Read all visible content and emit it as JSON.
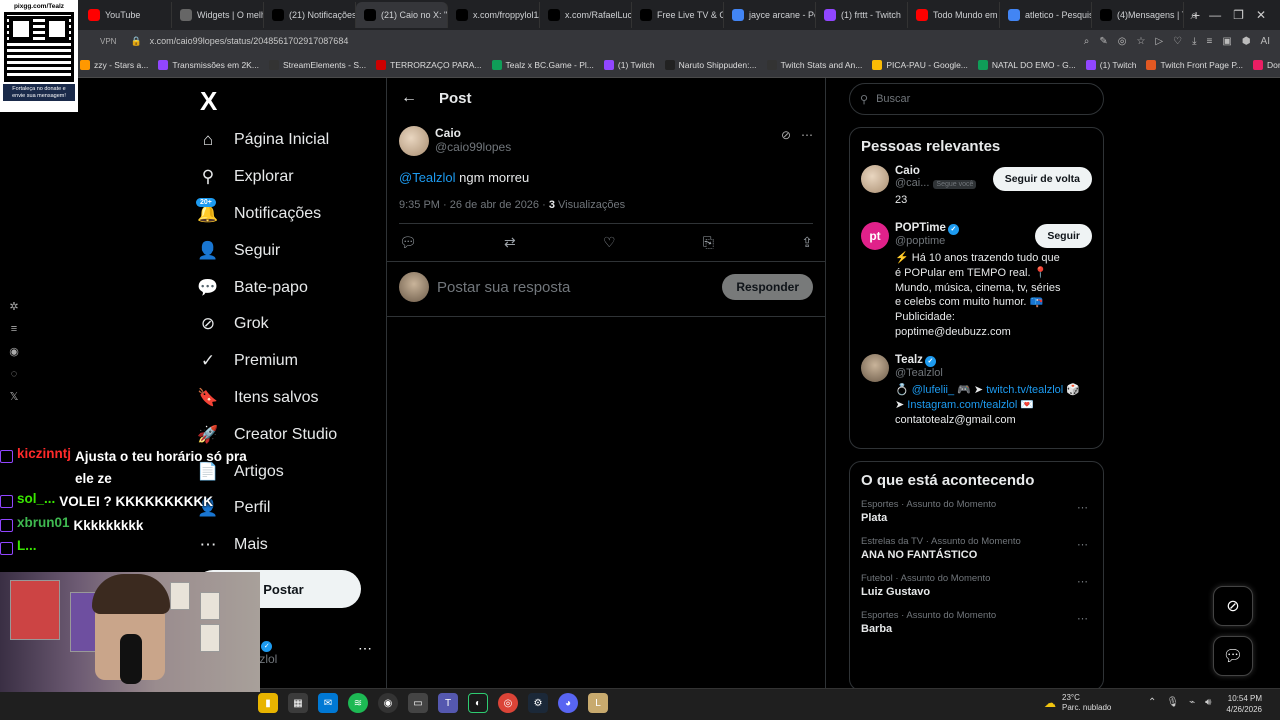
{
  "browser": {
    "tabs": [
      {
        "label": "YouTube",
        "color": "#ff0000"
      },
      {
        "label": "Widgets | O melh",
        "color": "#666"
      },
      {
        "label": "(21) Notificações",
        "color": "#000"
      },
      {
        "label": "(21) Caio no X: \"@popti",
        "color": "#000",
        "active": true
      },
      {
        "label": "x.com/froppylol1/",
        "color": "#000"
      },
      {
        "label": "x.com/RafaelLuce",
        "color": "#000"
      },
      {
        "label": "Free Live TV & On",
        "color": "#000"
      },
      {
        "label": "jayce arcane - Pes",
        "color": "#4285f4"
      },
      {
        "label": "(1) frttt - Twitch",
        "color": "#9146ff"
      },
      {
        "label": "Todo Mundo em",
        "color": "#ff0000"
      },
      {
        "label": "atletico - Pesquis",
        "color": "#4285f4"
      },
      {
        "label": "(4)Mensagens | Ti",
        "color": "#000"
      }
    ],
    "new_tab": "+",
    "vpn": "VPN",
    "url": "x.com/caio99lopes/status/2048561702917087684",
    "bookmarks": [
      {
        "label": "zzy - Stars a...",
        "color": "#ff9800"
      },
      {
        "label": "Transmissões em 2K...",
        "color": "#9146ff"
      },
      {
        "label": "StreamElements - S...",
        "color": "#333"
      },
      {
        "label": "TERRORZAÇO PARA...",
        "color": "#c00"
      },
      {
        "label": "Tealz x BC.Game - Pl...",
        "color": "#0f9d58"
      },
      {
        "label": "(1) Twitch",
        "color": "#9146ff"
      },
      {
        "label": "Naruto Shippuden:...",
        "color": "#222"
      },
      {
        "label": "Twitch Stats and An...",
        "color": "#333"
      },
      {
        "label": "PICA-PAU - Google...",
        "color": "#fbbc05"
      },
      {
        "label": "NATAL DO EMO - G...",
        "color": "#0f9d58"
      },
      {
        "label": "(1) Twitch",
        "color": "#9146ff"
      },
      {
        "label": "Twitch Front Page P...",
        "color": "#e25822"
      },
      {
        "label": "Domo da Mata - Ho...",
        "color": "#e91e63"
      }
    ]
  },
  "qr": {
    "top_text": "pixgg.com/Tealz",
    "bottom_text": "Fortaleça no donate e envie sua mensagem!"
  },
  "nav": {
    "logo": "X",
    "badge": "20+",
    "items": [
      {
        "label": "Página Inicial",
        "icon": "home-icon",
        "glyph": "⌂"
      },
      {
        "label": "Explorar",
        "icon": "search-icon",
        "glyph": "⚲"
      },
      {
        "label": "Notificações",
        "icon": "bell-icon",
        "glyph": "🔔"
      },
      {
        "label": "Seguir",
        "icon": "add-person-icon",
        "glyph": "👤"
      },
      {
        "label": "Bate-papo",
        "icon": "chat-icon",
        "glyph": "💬"
      },
      {
        "label": "Grok",
        "icon": "grok-icon",
        "glyph": "⊘"
      },
      {
        "label": "Premium",
        "icon": "premium-icon",
        "glyph": "✓"
      },
      {
        "label": "Itens salvos",
        "icon": "bookmark-icon",
        "glyph": "🔖"
      },
      {
        "label": "Creator Studio",
        "icon": "rocket-icon",
        "glyph": "🚀"
      },
      {
        "label": "Artigos",
        "icon": "articles-icon",
        "glyph": "📄"
      },
      {
        "label": "Perfil",
        "icon": "profile-icon",
        "glyph": "👤"
      },
      {
        "label": "Mais",
        "icon": "more-icon",
        "glyph": "⋯"
      }
    ],
    "post_button": "Postar",
    "profile_name": "z",
    "profile_handle": "alzlol"
  },
  "post": {
    "header_title": "Post",
    "author_name": "Caio",
    "author_handle": "@caio99lopes",
    "mention": "@Tealzlol",
    "text": " ngm morreu",
    "time": "9:35 PM · 26 de abr de 2026 · ",
    "views_count": "3",
    "views_label": " Visualizações",
    "reply_placeholder": "Postar sua resposta",
    "reply_button": "Responder"
  },
  "sidebar": {
    "search_placeholder": "Buscar",
    "relevant_title": "Pessoas relevantes",
    "people": [
      {
        "name": "Caio",
        "handle": "@cai...",
        "follows_you": "Segue você",
        "button": "Seguir de volta",
        "bio": "23"
      },
      {
        "name": "POPTime",
        "handle": "@poptime",
        "button": "Seguir",
        "bio": "⚡ Há 10 anos trazendo tudo que é POPular em TEMPO real. 📍 Mundo, música, cinema, tv, séries e celebs com muito humor. 📪 Publicidade: poptime@deubuzz.com"
      },
      {
        "name": "Tealz",
        "handle": "@Tealzlol",
        "bio_prefix": "💍 ",
        "bio_link1": "@lufelii_",
        "bio_mid": " 🎮 ➤ ",
        "bio_link2": "twitch.tv/tealzlol",
        "bio_mid2": " 🎲 ➤ ",
        "bio_link3": "Instagram.com/tealzlol",
        "bio_suffix": " 💌 contatotealz@gmail.com"
      }
    ],
    "trending_title": "O que está acontecendo",
    "trends": [
      {
        "category": "Esportes · Assunto do Momento",
        "name": "Plata"
      },
      {
        "category": "Estrelas da TV · Assunto do Momento",
        "name": "ANA NO FANTÁSTICO"
      },
      {
        "category": "Futebol · Assunto do Momento",
        "name": "Luiz Gustavo"
      },
      {
        "category": "Esportes · Assunto do Momento",
        "name": "Barba"
      }
    ]
  },
  "chat": [
    {
      "user": "kiczinntj",
      "color": "#ff2a2a",
      "message": "Ajusta o teu horário só pra ele ze"
    },
    {
      "user": "sol_...",
      "color": "#39e600",
      "message": "VOLEI ? KKKKKKKKKK"
    },
    {
      "user": "xbrun01",
      "color": "#3fb950",
      "message": "Kkkkkkkkk"
    },
    {
      "user": "L...",
      "color": "#39e600",
      "message": ""
    }
  ],
  "taskbar": {
    "temperature": "23°C",
    "weather": "Parc. nublado",
    "time": "10:54 PM",
    "date": "4/26/2026"
  }
}
